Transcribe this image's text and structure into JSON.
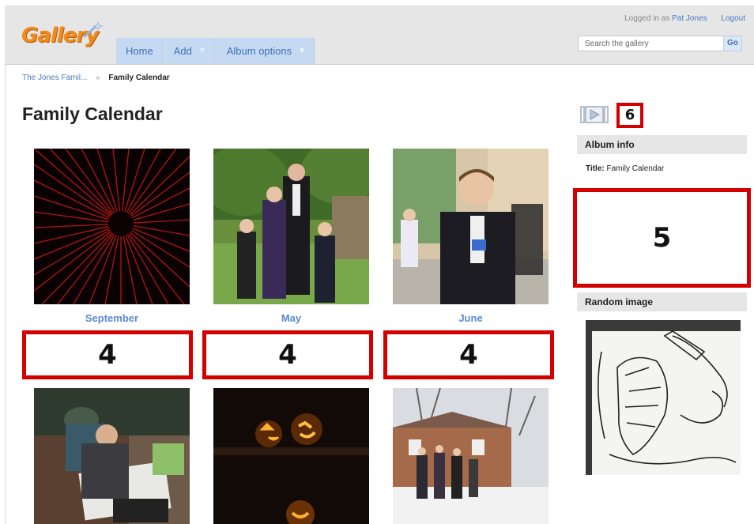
{
  "header": {
    "logo_text": "Gallery",
    "logged_in_prefix": "Logged in as",
    "user_name": "Pat Jones",
    "logout_label": "Logout",
    "search_placeholder": "Search the gallery",
    "go_label": "Go"
  },
  "nav": {
    "home": "Home",
    "add": "Add",
    "album_options": "Album options"
  },
  "breadcrumb": {
    "parent": "The Jones Famil...",
    "separator": "»",
    "current": "Family Calendar"
  },
  "page_title": "Family Calendar",
  "albums": [
    {
      "caption": "September",
      "count": "4"
    },
    {
      "caption": "May",
      "count": "4"
    },
    {
      "caption": "June",
      "count": "4"
    }
  ],
  "sidebar": {
    "slideshow_badge": "6",
    "album_info_heading": "Album info",
    "title_label": "Title:",
    "title_value": "Family Calendar",
    "info_box_number": "5",
    "random_image_heading": "Random image"
  },
  "colors": {
    "accent": "#4a7ac0",
    "nav_bg": "#c5daf2",
    "annotation_red": "#d40000",
    "logo_orange": "#f08a1c"
  }
}
